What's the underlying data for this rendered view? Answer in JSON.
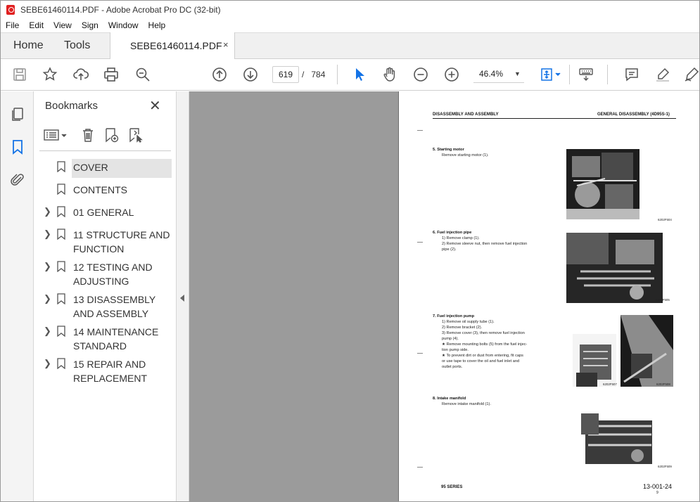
{
  "window": {
    "title": "SEBE61460114.PDF - Adobe Acrobat Pro DC (32-bit)"
  },
  "menu": [
    "File",
    "Edit",
    "View",
    "Sign",
    "Window",
    "Help"
  ],
  "tabs": {
    "home": "Home",
    "tools": "Tools",
    "document": "SEBE61460114.PDF",
    "close_glyph": "×"
  },
  "toolbar": {
    "current_page": "619",
    "page_separator": "/",
    "total_pages": "784",
    "zoom": "46.4%"
  },
  "bookmarks": {
    "title": "Bookmarks",
    "close_glyph": "✕",
    "items": [
      {
        "label": "COVER",
        "expandable": false,
        "selected": true
      },
      {
        "label": "CONTENTS",
        "expandable": false,
        "selected": false
      },
      {
        "label": "01 GENERAL",
        "expandable": true,
        "selected": false
      },
      {
        "label": "11 STRUCTURE AND FUNCTION",
        "expandable": true,
        "selected": false
      },
      {
        "label": "12 TESTING AND ADJUSTING",
        "expandable": true,
        "selected": false
      },
      {
        "label": "13 DISASSEMBLY AND ASSEMBLY",
        "expandable": true,
        "selected": false
      },
      {
        "label": "14 MAINTENANCE STANDARD",
        "expandable": true,
        "selected": false
      },
      {
        "label": "15 REPAIR AND REPLACEMENT",
        "expandable": true,
        "selected": false
      }
    ]
  },
  "page": {
    "header_left": "DISASSEMBLY AND ASSEMBLY",
    "header_right": "GENERAL DISASSEMBLY (4D95S-1)",
    "steps": [
      {
        "title": "5.   Starting motor",
        "lines": [
          "Remove starting motor (1)."
        ],
        "photos": [
          "6202F504"
        ]
      },
      {
        "title": "6.   Fuel injection pipe",
        "lines": [
          "1)   Remove clamp (1).",
          "2)   Remove sleeve nut, then remove fuel injection",
          "      pipe (2)."
        ],
        "photos": [
          "6202F505"
        ]
      },
      {
        "title": "7.   Fuel injection pump",
        "lines": [
          "1)   Remove oil supply tube (1).",
          "2)   Remove bracket (2).",
          "3)   Remove cover (3), then remove fuel injection",
          "      pump (4).",
          "      ★  Remove mounting bolts (5) from the fuel injec-",
          "          tion pump side.",
          "      ★  To prevent dirt or dust from entering, fit caps",
          "          or use tape to cover the oil and fuel inlet and",
          "          outlet ports."
        ],
        "photos": [
          "6202F507",
          "6202F508"
        ]
      },
      {
        "title": "8.   Intake manifold",
        "lines": [
          "Remove intake manifold (1)."
        ],
        "photos": [
          "6202F509"
        ]
      }
    ],
    "footer_left": "95 SERIES",
    "footer_right": "13-001-24",
    "footer_sub": "9"
  },
  "colors": {
    "accent": "#1473e6",
    "app_icon": "#e02020",
    "page_bg": "#9b9b9b"
  }
}
